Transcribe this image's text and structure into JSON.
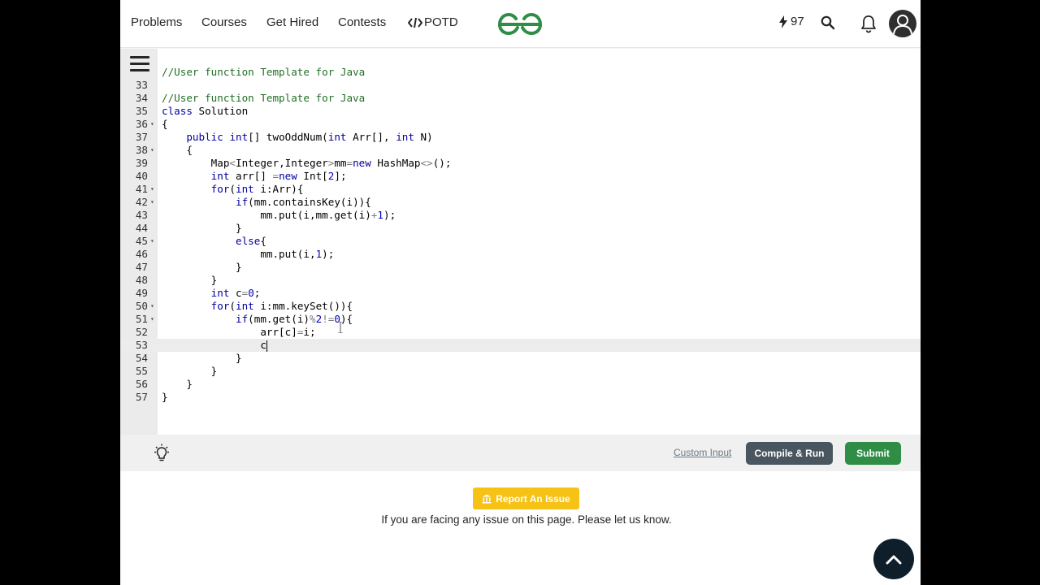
{
  "navbar": {
    "links": [
      "Problems",
      "Courses",
      "Get Hired",
      "Contests",
      "POTD"
    ],
    "potd_icon": "code-bracket-icon",
    "logo": "geeksforgeeks-logo",
    "streak_icon": "lightning-icon",
    "streak_count": "97",
    "search_icon": "search-icon",
    "bell_icon": "bell-icon",
    "avatar_icon": "user-avatar-icon",
    "accent_color": "#2f8d46"
  },
  "editor": {
    "menu_icon": "hamburger-menu-icon",
    "top_line": "//User function Template for Java",
    "lines": [
      {
        "num": "33",
        "fold": false,
        "text": ""
      },
      {
        "num": "34",
        "fold": false,
        "text": "//User function Template for Java"
      },
      {
        "num": "35",
        "fold": false,
        "text": "class Solution"
      },
      {
        "num": "36",
        "fold": true,
        "text": "{"
      },
      {
        "num": "37",
        "fold": false,
        "text": "    public int[] twoOddNum(int Arr[], int N)"
      },
      {
        "num": "38",
        "fold": true,
        "text": "    {"
      },
      {
        "num": "39",
        "fold": false,
        "text": "        Map<Integer,Integer>mm=new HashMap<>();"
      },
      {
        "num": "40",
        "fold": false,
        "text": "        int arr[] =new Int[2];"
      },
      {
        "num": "41",
        "fold": true,
        "text": "        for(int i:Arr){"
      },
      {
        "num": "42",
        "fold": true,
        "text": "            if(mm.containsKey(i)){"
      },
      {
        "num": "43",
        "fold": false,
        "text": "                mm.put(i,mm.get(i)+1);"
      },
      {
        "num": "44",
        "fold": false,
        "text": "            }"
      },
      {
        "num": "45",
        "fold": true,
        "text": "            else{"
      },
      {
        "num": "46",
        "fold": false,
        "text": "                mm.put(i,1);"
      },
      {
        "num": "47",
        "fold": false,
        "text": "            }"
      },
      {
        "num": "48",
        "fold": false,
        "text": "        }"
      },
      {
        "num": "49",
        "fold": false,
        "text": "        int c=0;"
      },
      {
        "num": "50",
        "fold": true,
        "text": "        for(int i:mm.keySet()){"
      },
      {
        "num": "51",
        "fold": true,
        "text": "            if(mm.get(i)%2!=0){"
      },
      {
        "num": "52",
        "fold": false,
        "text": "                arr[c]=i;"
      },
      {
        "num": "53",
        "fold": false,
        "text": "                c"
      },
      {
        "num": "54",
        "fold": false,
        "text": "            }"
      },
      {
        "num": "55",
        "fold": false,
        "text": "        }"
      },
      {
        "num": "56",
        "fold": false,
        "text": "    }"
      },
      {
        "num": "57",
        "fold": false,
        "text": "}"
      }
    ],
    "active_line": "53"
  },
  "actions": {
    "bulb_icon": "lightbulb-icon",
    "custom_input": "Custom Input",
    "compile_run": "Compile & Run",
    "submit": "Submit"
  },
  "report": {
    "icon": "bank-icon",
    "button": "Report An Issue",
    "text": "If you are facing any issue on this page. Please let us know."
  },
  "scroll_top_icon": "chevron-up-icon"
}
